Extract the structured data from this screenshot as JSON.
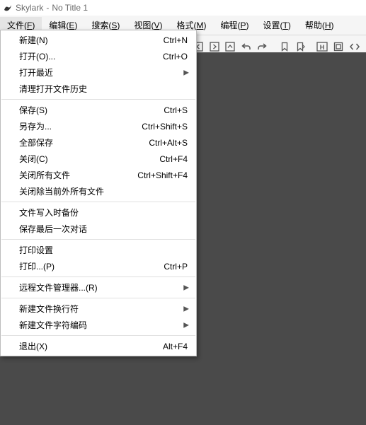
{
  "app": {
    "name": "Skylark",
    "doc": "No Title 1",
    "title_sep": " - "
  },
  "menubar": [
    {
      "id": "file",
      "label": "文件",
      "mn": "F",
      "active": true
    },
    {
      "id": "edit",
      "label": "编辑",
      "mn": "E"
    },
    {
      "id": "search",
      "label": "搜索",
      "mn": "S"
    },
    {
      "id": "view",
      "label": "视图",
      "mn": "V"
    },
    {
      "id": "format",
      "label": "格式",
      "mn": "M"
    },
    {
      "id": "program",
      "label": "编程",
      "mn": "P"
    },
    {
      "id": "settings",
      "label": "设置",
      "mn": "T"
    },
    {
      "id": "help",
      "label": "帮助",
      "mn": "H"
    }
  ],
  "file_menu": {
    "groups": [
      [
        {
          "id": "new",
          "label": "新建(N)",
          "accel": "Ctrl+N"
        },
        {
          "id": "open",
          "label": "打开(O)...",
          "accel": "Ctrl+O"
        },
        {
          "id": "open-recent",
          "label": "打开最近",
          "submenu": true
        },
        {
          "id": "clear-recent",
          "label": "清理打开文件历史"
        }
      ],
      [
        {
          "id": "save",
          "label": "保存(S)",
          "accel": "Ctrl+S"
        },
        {
          "id": "save-as",
          "label": "另存为...",
          "accel": "Ctrl+Shift+S"
        },
        {
          "id": "save-all",
          "label": "全部保存",
          "accel": "Ctrl+Alt+S"
        },
        {
          "id": "close",
          "label": "关闭(C)",
          "accel": "Ctrl+F4"
        },
        {
          "id": "close-all",
          "label": "关闭所有文件",
          "accel": "Ctrl+Shift+F4"
        },
        {
          "id": "close-others",
          "label": "关闭除当前外所有文件"
        }
      ],
      [
        {
          "id": "backup-on-write",
          "label": "文件写入时备份"
        },
        {
          "id": "save-session",
          "label": "保存最后一次对话"
        }
      ],
      [
        {
          "id": "print-setup",
          "label": "打印设置"
        },
        {
          "id": "print",
          "label": "打印...(P)",
          "accel": "Ctrl+P"
        }
      ],
      [
        {
          "id": "remote-files",
          "label": "远程文件管理器...(R)",
          "submenu": true
        }
      ],
      [
        {
          "id": "new-lineending",
          "label": "新建文件换行符",
          "submenu": true
        },
        {
          "id": "new-encoding",
          "label": "新建文件字符编码",
          "submenu": true
        }
      ],
      [
        {
          "id": "exit",
          "label": "退出(X)",
          "accel": "Alt+F4"
        }
      ]
    ]
  },
  "toolbar_icons": [
    "search-icon",
    "nav-left-icon",
    "nav-right-icon",
    "nav-up-icon",
    "undo-icon",
    "redo-icon",
    "bookmark-icon",
    "bookmark-jump-icon",
    "highlight-icon",
    "hex-icon",
    "code-icon"
  ]
}
